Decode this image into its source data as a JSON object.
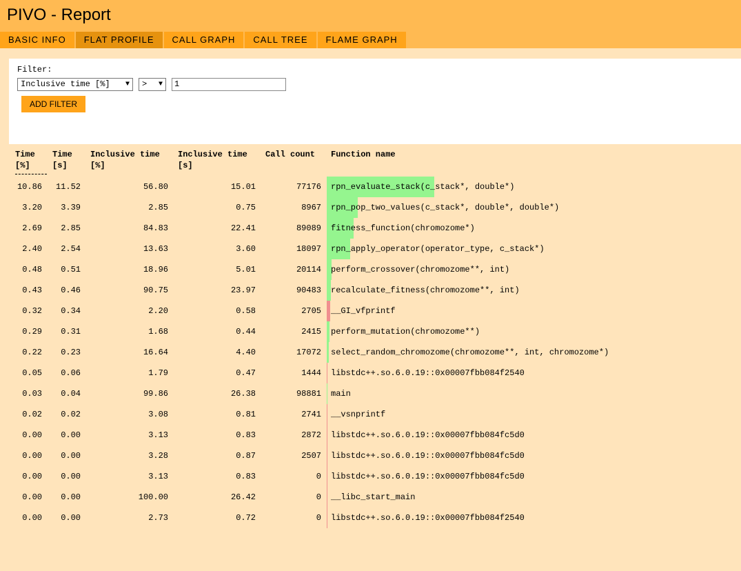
{
  "app": {
    "title": "PIVO - Report"
  },
  "tabs": [
    {
      "label": "BASIC INFO",
      "active": false
    },
    {
      "label": "FLAT PROFILE",
      "active": true
    },
    {
      "label": "CALL GRAPH",
      "active": false
    },
    {
      "label": "CALL TREE",
      "active": false
    },
    {
      "label": "FLAME GRAPH",
      "active": false
    }
  ],
  "filter": {
    "label": "Filter:",
    "field_value": "Inclusive time [%]",
    "operator_value": ">",
    "threshold_value": "1",
    "add_button_label": "ADD FILTER"
  },
  "table": {
    "headers": [
      {
        "line1": "Time",
        "line2": "[%]"
      },
      {
        "line1": "Time",
        "line2": "[s]"
      },
      {
        "line1": "Inclusive time",
        "line2": "[%]"
      },
      {
        "line1": "Inclusive time",
        "line2": "[s]"
      },
      {
        "line1": "Call count",
        "line2": ""
      },
      {
        "line1": "Function name",
        "line2": ""
      }
    ],
    "rows": [
      {
        "time_pct": "10.86",
        "time_s": "11.52",
        "incl_pct": "56.80",
        "incl_s": "15.01",
        "calls": "77176",
        "func": "rpn_evaluate_stack(c_stack*, double*)",
        "bar_fraction": 1.0,
        "bar_color": "#95f58f"
      },
      {
        "time_pct": "3.20",
        "time_s": "3.39",
        "incl_pct": "2.85",
        "incl_s": "0.75",
        "calls": "8967",
        "func": "rpn_pop_two_values(c_stack*, double*, double*)",
        "bar_fraction": 0.29,
        "bar_color": "#95f58f"
      },
      {
        "time_pct": "2.69",
        "time_s": "2.85",
        "incl_pct": "84.83",
        "incl_s": "22.41",
        "calls": "89089",
        "func": "fitness_function(chromozome*)",
        "bar_fraction": 0.25,
        "bar_color": "#95f58f"
      },
      {
        "time_pct": "2.40",
        "time_s": "2.54",
        "incl_pct": "13.63",
        "incl_s": "3.60",
        "calls": "18097",
        "func": "rpn_apply_operator(operator_type, c_stack*)",
        "bar_fraction": 0.22,
        "bar_color": "#95f58f"
      },
      {
        "time_pct": "0.48",
        "time_s": "0.51",
        "incl_pct": "18.96",
        "incl_s": "5.01",
        "calls": "20114",
        "func": "perform_crossover(chromozome**, int)",
        "bar_fraction": 0.045,
        "bar_color": "#95f58f"
      },
      {
        "time_pct": "0.43",
        "time_s": "0.46",
        "incl_pct": "90.75",
        "incl_s": "23.97",
        "calls": "90483",
        "func": "recalculate_fitness(chromozome**, int)",
        "bar_fraction": 0.04,
        "bar_color": "#95f58f"
      },
      {
        "time_pct": "0.32",
        "time_s": "0.34",
        "incl_pct": "2.20",
        "incl_s": "0.58",
        "calls": "2705",
        "func": "__GI_vfprintf",
        "bar_fraction": 0.03,
        "bar_color": "#f08f8f"
      },
      {
        "time_pct": "0.29",
        "time_s": "0.31",
        "incl_pct": "1.68",
        "incl_s": "0.44",
        "calls": "2415",
        "func": "perform_mutation(chromozome**)",
        "bar_fraction": 0.027,
        "bar_color": "#95f58f"
      },
      {
        "time_pct": "0.22",
        "time_s": "0.23",
        "incl_pct": "16.64",
        "incl_s": "4.40",
        "calls": "17072",
        "func": "select_random_chromozome(chromozome**, int, chromozome*)",
        "bar_fraction": 0.02,
        "bar_color": "#95f58f"
      },
      {
        "time_pct": "0.05",
        "time_s": "0.06",
        "incl_pct": "1.79",
        "incl_s": "0.47",
        "calls": "1444",
        "func": "libstdc++.so.6.0.19::0x00007fbb084f2540",
        "bar_fraction": 0.007,
        "bar_color": "#f08f8f"
      },
      {
        "time_pct": "0.03",
        "time_s": "0.04",
        "incl_pct": "99.86",
        "incl_s": "26.38",
        "calls": "98881",
        "func": "main",
        "bar_fraction": 0.005,
        "bar_color": "#95f58f"
      },
      {
        "time_pct": "0.02",
        "time_s": "0.02",
        "incl_pct": "3.08",
        "incl_s": "0.81",
        "calls": "2741",
        "func": "__vsnprintf",
        "bar_fraction": 0.005,
        "bar_color": "#f08f8f"
      },
      {
        "time_pct": "0.00",
        "time_s": "0.00",
        "incl_pct": "3.13",
        "incl_s": "0.83",
        "calls": "2872",
        "func": "libstdc++.so.6.0.19::0x00007fbb084fc5d0",
        "bar_fraction": 0,
        "bar_color": "#f08f8f"
      },
      {
        "time_pct": "0.00",
        "time_s": "0.00",
        "incl_pct": "3.28",
        "incl_s": "0.87",
        "calls": "2507",
        "func": "libstdc++.so.6.0.19::0x00007fbb084fc5d0",
        "bar_fraction": 0,
        "bar_color": "#f08f8f"
      },
      {
        "time_pct": "0.00",
        "time_s": "0.00",
        "incl_pct": "3.13",
        "incl_s": "0.83",
        "calls": "0",
        "func": "libstdc++.so.6.0.19::0x00007fbb084fc5d0",
        "bar_fraction": 0,
        "bar_color": "#f08f8f"
      },
      {
        "time_pct": "0.00",
        "time_s": "0.00",
        "incl_pct": "100.00",
        "incl_s": "26.42",
        "calls": "0",
        "func": "__libc_start_main",
        "bar_fraction": 0,
        "bar_color": "#f08f8f"
      },
      {
        "time_pct": "0.00",
        "time_s": "0.00",
        "incl_pct": "2.73",
        "incl_s": "0.72",
        "calls": "0",
        "func": "libstdc++.so.6.0.19::0x00007fbb084f2540",
        "bar_fraction": 0,
        "bar_color": "#f08f8f"
      }
    ]
  }
}
